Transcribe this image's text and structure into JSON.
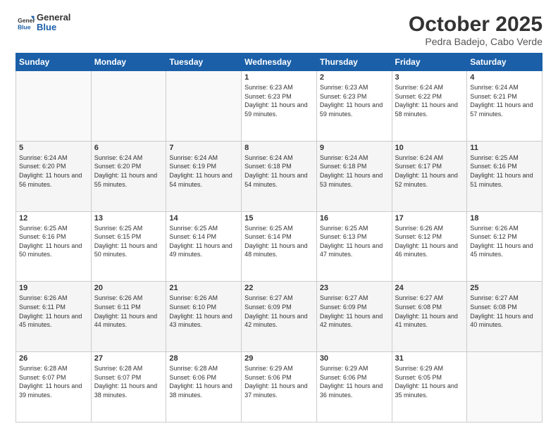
{
  "logo": {
    "line1": "General",
    "line2": "Blue"
  },
  "title": "October 2025",
  "location": "Pedra Badejo, Cabo Verde",
  "days_of_week": [
    "Sunday",
    "Monday",
    "Tuesday",
    "Wednesday",
    "Thursday",
    "Friday",
    "Saturday"
  ],
  "weeks": [
    [
      {
        "day": "",
        "info": ""
      },
      {
        "day": "",
        "info": ""
      },
      {
        "day": "",
        "info": ""
      },
      {
        "day": "1",
        "info": "Sunrise: 6:23 AM\nSunset: 6:23 PM\nDaylight: 11 hours and 59 minutes."
      },
      {
        "day": "2",
        "info": "Sunrise: 6:23 AM\nSunset: 6:23 PM\nDaylight: 11 hours and 59 minutes."
      },
      {
        "day": "3",
        "info": "Sunrise: 6:24 AM\nSunset: 6:22 PM\nDaylight: 11 hours and 58 minutes."
      },
      {
        "day": "4",
        "info": "Sunrise: 6:24 AM\nSunset: 6:21 PM\nDaylight: 11 hours and 57 minutes."
      }
    ],
    [
      {
        "day": "5",
        "info": "Sunrise: 6:24 AM\nSunset: 6:20 PM\nDaylight: 11 hours and 56 minutes."
      },
      {
        "day": "6",
        "info": "Sunrise: 6:24 AM\nSunset: 6:20 PM\nDaylight: 11 hours and 55 minutes."
      },
      {
        "day": "7",
        "info": "Sunrise: 6:24 AM\nSunset: 6:19 PM\nDaylight: 11 hours and 54 minutes."
      },
      {
        "day": "8",
        "info": "Sunrise: 6:24 AM\nSunset: 6:18 PM\nDaylight: 11 hours and 54 minutes."
      },
      {
        "day": "9",
        "info": "Sunrise: 6:24 AM\nSunset: 6:18 PM\nDaylight: 11 hours and 53 minutes."
      },
      {
        "day": "10",
        "info": "Sunrise: 6:24 AM\nSunset: 6:17 PM\nDaylight: 11 hours and 52 minutes."
      },
      {
        "day": "11",
        "info": "Sunrise: 6:25 AM\nSunset: 6:16 PM\nDaylight: 11 hours and 51 minutes."
      }
    ],
    [
      {
        "day": "12",
        "info": "Sunrise: 6:25 AM\nSunset: 6:16 PM\nDaylight: 11 hours and 50 minutes."
      },
      {
        "day": "13",
        "info": "Sunrise: 6:25 AM\nSunset: 6:15 PM\nDaylight: 11 hours and 50 minutes."
      },
      {
        "day": "14",
        "info": "Sunrise: 6:25 AM\nSunset: 6:14 PM\nDaylight: 11 hours and 49 minutes."
      },
      {
        "day": "15",
        "info": "Sunrise: 6:25 AM\nSunset: 6:14 PM\nDaylight: 11 hours and 48 minutes."
      },
      {
        "day": "16",
        "info": "Sunrise: 6:25 AM\nSunset: 6:13 PM\nDaylight: 11 hours and 47 minutes."
      },
      {
        "day": "17",
        "info": "Sunrise: 6:26 AM\nSunset: 6:12 PM\nDaylight: 11 hours and 46 minutes."
      },
      {
        "day": "18",
        "info": "Sunrise: 6:26 AM\nSunset: 6:12 PM\nDaylight: 11 hours and 45 minutes."
      }
    ],
    [
      {
        "day": "19",
        "info": "Sunrise: 6:26 AM\nSunset: 6:11 PM\nDaylight: 11 hours and 45 minutes."
      },
      {
        "day": "20",
        "info": "Sunrise: 6:26 AM\nSunset: 6:11 PM\nDaylight: 11 hours and 44 minutes."
      },
      {
        "day": "21",
        "info": "Sunrise: 6:26 AM\nSunset: 6:10 PM\nDaylight: 11 hours and 43 minutes."
      },
      {
        "day": "22",
        "info": "Sunrise: 6:27 AM\nSunset: 6:09 PM\nDaylight: 11 hours and 42 minutes."
      },
      {
        "day": "23",
        "info": "Sunrise: 6:27 AM\nSunset: 6:09 PM\nDaylight: 11 hours and 42 minutes."
      },
      {
        "day": "24",
        "info": "Sunrise: 6:27 AM\nSunset: 6:08 PM\nDaylight: 11 hours and 41 minutes."
      },
      {
        "day": "25",
        "info": "Sunrise: 6:27 AM\nSunset: 6:08 PM\nDaylight: 11 hours and 40 minutes."
      }
    ],
    [
      {
        "day": "26",
        "info": "Sunrise: 6:28 AM\nSunset: 6:07 PM\nDaylight: 11 hours and 39 minutes."
      },
      {
        "day": "27",
        "info": "Sunrise: 6:28 AM\nSunset: 6:07 PM\nDaylight: 11 hours and 38 minutes."
      },
      {
        "day": "28",
        "info": "Sunrise: 6:28 AM\nSunset: 6:06 PM\nDaylight: 11 hours and 38 minutes."
      },
      {
        "day": "29",
        "info": "Sunrise: 6:29 AM\nSunset: 6:06 PM\nDaylight: 11 hours and 37 minutes."
      },
      {
        "day": "30",
        "info": "Sunrise: 6:29 AM\nSunset: 6:06 PM\nDaylight: 11 hours and 36 minutes."
      },
      {
        "day": "31",
        "info": "Sunrise: 6:29 AM\nSunset: 6:05 PM\nDaylight: 11 hours and 35 minutes."
      },
      {
        "day": "",
        "info": ""
      }
    ]
  ]
}
